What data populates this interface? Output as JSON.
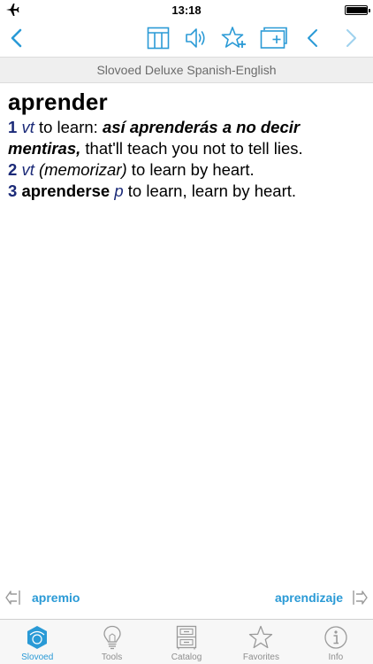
{
  "status_bar": {
    "time": "13:18",
    "airplane_icon": "airplane-icon",
    "battery_level": 0.95
  },
  "colors": {
    "accent": "#2a9ad6",
    "sense_blue": "#1b2a78"
  },
  "toolbar": {
    "icons": [
      "back-chevron-icon",
      "table-icon",
      "speaker-icon",
      "add-favorite-star-icon",
      "add-card-icon",
      "previous-chevron-icon",
      "next-chevron-icon"
    ]
  },
  "dictionary": {
    "title": "Slovoed Deluxe Spanish-English"
  },
  "entry": {
    "headword": "aprender",
    "senses": [
      {
        "num": "1",
        "pos": "vt",
        "text_a": " to learn: ",
        "example": "así aprenderás a no decir mentiras,",
        "text_b": " that'll teach you not to tell lies."
      },
      {
        "num": "2",
        "pos": "vt",
        "gram": "(memorizar)",
        "text_a": " to learn by heart."
      },
      {
        "num": "3",
        "phrase": "aprenderse",
        "pos": "p",
        "text_a": " to learn, learn by heart."
      }
    ]
  },
  "navigation": {
    "prev_label": "apremio",
    "next_label": "aprendizaje"
  },
  "tabs": [
    {
      "label": "Slovoed",
      "icon": "slovoed-logo-icon",
      "active": true
    },
    {
      "label": "Tools",
      "icon": "lightbulb-icon",
      "active": false
    },
    {
      "label": "Catalog",
      "icon": "cabinet-icon",
      "active": false
    },
    {
      "label": "Favorites",
      "icon": "star-icon",
      "active": false
    },
    {
      "label": "Info",
      "icon": "info-icon",
      "active": false
    }
  ]
}
